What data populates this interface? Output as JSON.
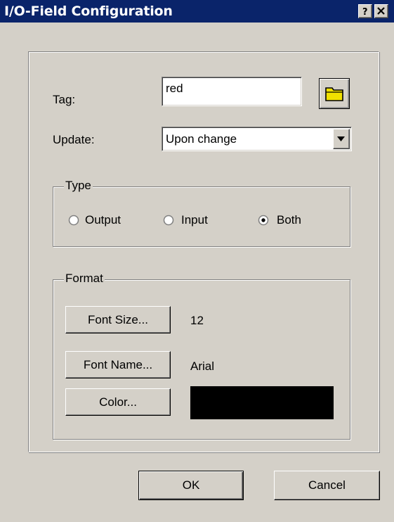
{
  "window": {
    "title": "I/O-Field Configuration"
  },
  "titlebar_buttons": {
    "help_icon": "question-mark",
    "close_icon": "x"
  },
  "tag": {
    "label": "Tag:",
    "value": "red",
    "browse_icon": "folder-icon"
  },
  "update": {
    "label": "Update:",
    "value": "Upon change",
    "dropdown_icon": "chevron-down-icon"
  },
  "type_group": {
    "legend": "Type",
    "options": [
      {
        "label": "Output",
        "selected": false
      },
      {
        "label": "Input",
        "selected": false
      },
      {
        "label": "Both",
        "selected": true
      }
    ]
  },
  "format_group": {
    "legend": "Format",
    "font_size": {
      "button": "Font Size...",
      "value": "12"
    },
    "font_name": {
      "button": "Font Name...",
      "value": "Arial"
    },
    "color": {
      "button": "Color...",
      "value": "#000000"
    }
  },
  "footer": {
    "ok": "OK",
    "cancel": "Cancel"
  },
  "colors": {
    "titlebar": "#0a246a",
    "face": "#d4d0c8",
    "folder": "#f0e000"
  }
}
